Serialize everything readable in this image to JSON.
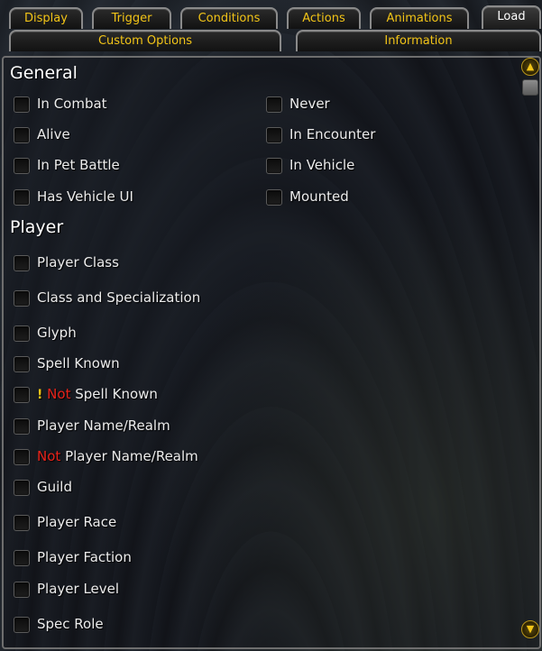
{
  "tabs": {
    "display": "Display",
    "trigger": "Trigger",
    "conditions": "Conditions",
    "actions": "Actions",
    "animations": "Animations",
    "load": "Load",
    "custom_options": "Custom Options",
    "information": "Information",
    "active": "Load"
  },
  "general": {
    "title": "General",
    "items": [
      {
        "label": "In Combat"
      },
      {
        "label": "Never"
      },
      {
        "label": "Alive"
      },
      {
        "label": "In Encounter"
      },
      {
        "label": "In Pet Battle"
      },
      {
        "label": "In Vehicle"
      },
      {
        "label": "Has Vehicle UI"
      },
      {
        "label": "Mounted"
      }
    ]
  },
  "player": {
    "title": "Player",
    "items": [
      {
        "label": "Player Class"
      },
      {
        "label": "Class and Specialization"
      },
      {
        "label": "Glyph"
      },
      {
        "label": "Spell Known"
      },
      {
        "prefix_icon": "exclamation-icon",
        "not": "Not",
        "label": "Spell Known"
      },
      {
        "label": "Player Name/Realm"
      },
      {
        "not": "Not",
        "label": "Player Name/Realm"
      },
      {
        "label": "Guild"
      },
      {
        "label": "Player Race"
      },
      {
        "label": "Player Faction"
      },
      {
        "label": "Player Level"
      },
      {
        "label": "Spec Role"
      }
    ]
  },
  "colors": {
    "tab_text": "#f2c417",
    "active_tab_text": "#ffffff",
    "not_text": "#e8231a"
  },
  "scrollbar": {
    "up_icon": "chevron-up-icon",
    "down_icon": "chevron-down-icon"
  }
}
